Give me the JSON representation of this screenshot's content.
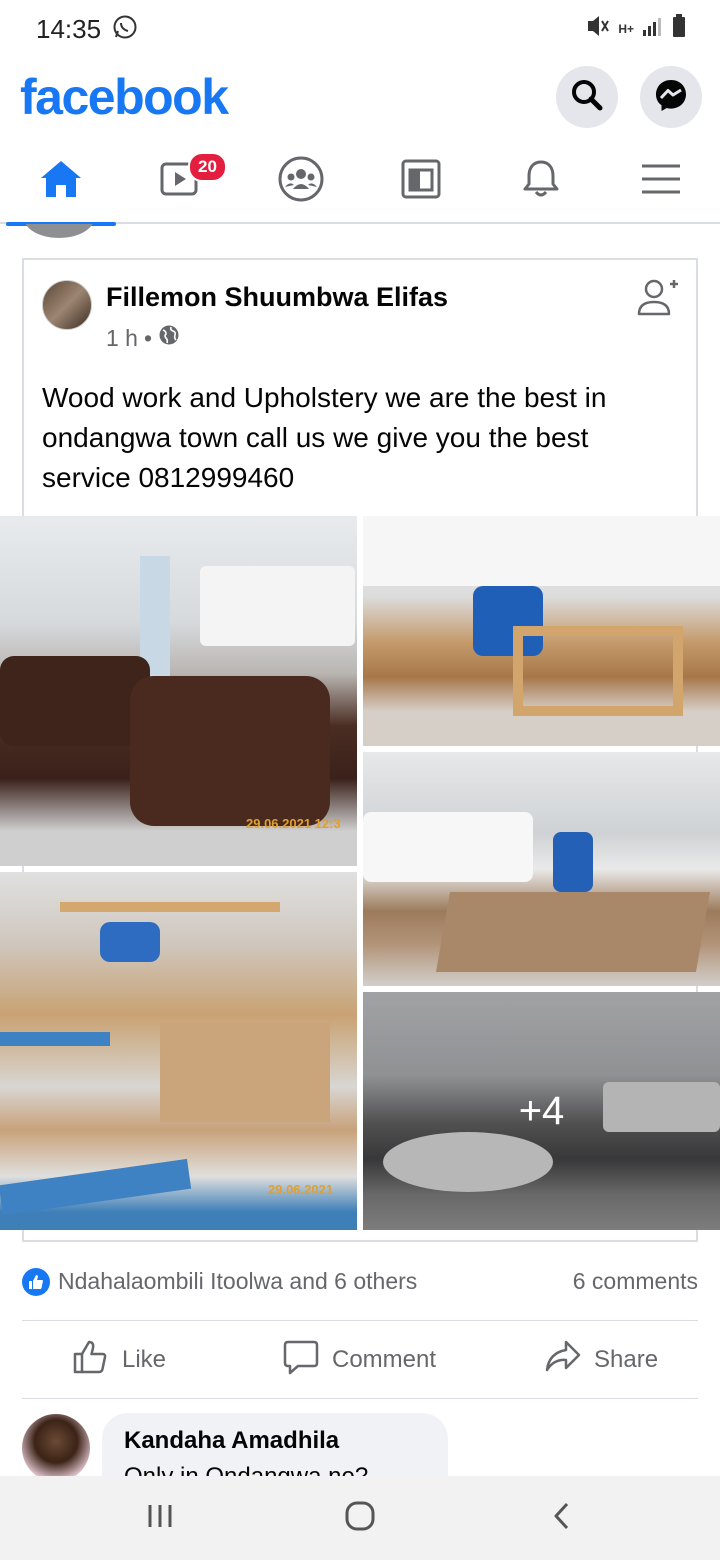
{
  "status_bar": {
    "time": "14:35",
    "network": "H+"
  },
  "header": {
    "logo": "facebook"
  },
  "tabs": [
    {
      "name": "home",
      "active": true
    },
    {
      "name": "watch",
      "badge": "20"
    },
    {
      "name": "groups"
    },
    {
      "name": "pages"
    },
    {
      "name": "notifications"
    },
    {
      "name": "menu"
    }
  ],
  "post": {
    "author": "Fillemon Shuumbwa Elifas",
    "time": "1 h",
    "text": "Wood work and Upholstery we are the best in ondangwa town call us we give you the best service 0812999460",
    "photo_stamps": [
      "29.06.2021 12:3",
      "29.06.2021"
    ],
    "more_photos": "+4",
    "reactions_text": "Ndahalaombili Itoolwa and 6 others",
    "comments_count": "6 comments"
  },
  "actions": {
    "like": "Like",
    "comment": "Comment",
    "share": "Share"
  },
  "comment": {
    "author": "Kandaha Amadhila",
    "text": "Only in Ondangwa ne?"
  },
  "colors": {
    "brand": "#1877f2",
    "badge": "#e41e3f"
  }
}
